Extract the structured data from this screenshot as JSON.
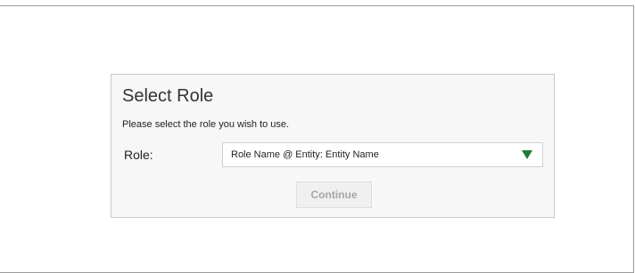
{
  "dialog": {
    "title": "Select Role",
    "instruction": "Please select the role you wish to use.",
    "role_label": "Role:",
    "role_select": {
      "selected_value": "Role Name @ Entity: Entity Name",
      "icon": "dropdown-arrow-icon",
      "icon_color": "#1f7a3e"
    },
    "continue_label": "Continue",
    "continue_enabled": false
  }
}
